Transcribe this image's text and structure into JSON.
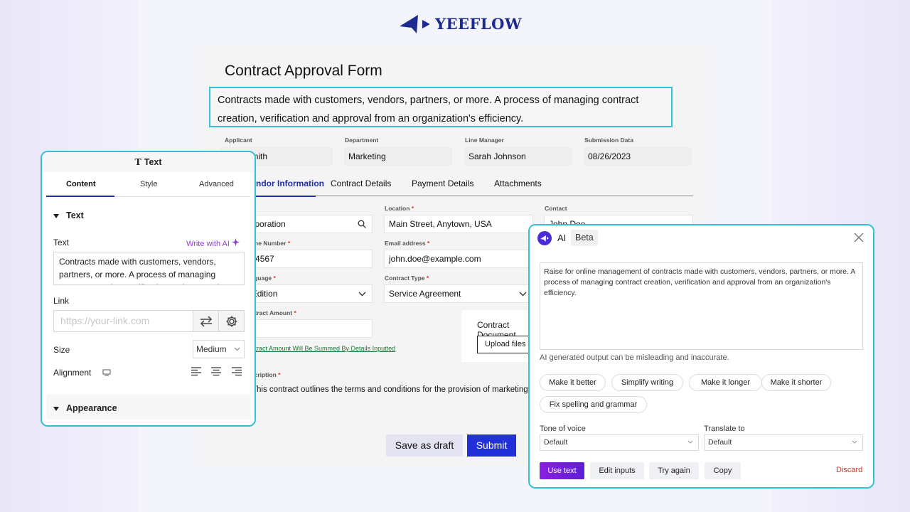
{
  "brand": {
    "name": "YEEFLOW",
    "color": "#1d2a8f"
  },
  "form": {
    "title": "Contract Approval Form",
    "description": "Contracts made with customers, vendors, partners, or more. A process of managing contract creation, verification and approval from an organization's efficiency.",
    "fields": {
      "applicant_label": "Applicant",
      "applicant_value": "John Smith",
      "department_label": "Department",
      "department_value": "Marketing",
      "manager_label": "Line Manager",
      "manager_value": "Sarah Johnson",
      "submission_label": "Submission Data",
      "submission_value": "08/26/2023"
    },
    "tabs": [
      "Vendor Information",
      "Contract Details",
      "Payment Details",
      "Attachments"
    ],
    "vendor": {
      "vendor_value": "ABC Corporation",
      "location_label": "Location",
      "location_value": "Main Street, Anytown, USA",
      "contact_label": "Contact",
      "contact_value": "John Doe",
      "phone_label": "Phone Number",
      "phone_value": "555-123-4567",
      "email_label": "Email address",
      "email_value": "john.doe@example.com",
      "language_label": "Language",
      "language_value": "English Edition",
      "type_label": "Contract Type",
      "type_value": "Service Agreement",
      "amount_label": "Contract Amount",
      "sum_note": "Contract Amount Will Be Summed By Details Inputted",
      "doc_title": "Contract Document",
      "upload_label": "Upload files",
      "desc_label": "Description",
      "desc_value": "This contract outlines the terms and conditions for the provision of marketing services"
    },
    "actions": {
      "draft": "Save as draft",
      "submit": "Submit"
    },
    "colors": {
      "accent": "#2130a8",
      "submit": "#2130d8",
      "highlight": "#34c1d8"
    }
  },
  "text_panel": {
    "header": "Text",
    "tabs": [
      "Content",
      "Style",
      "Advanced"
    ],
    "section_text": "Text",
    "text_label": "Text",
    "write_ai": "Write with AI",
    "text_value": "Contracts made with customers, vendors, partners, or more. A process of managing contract creation, verification and approval",
    "link_label": "Link",
    "link_placeholder": "https://your-link.com",
    "size_label": "Size",
    "size_value": "Medium",
    "alignment_label": "Alignment",
    "section_appearance": "Appearance"
  },
  "ai_panel": {
    "title": "AI",
    "badge": "Beta",
    "output": "Raise for online management of contracts made with customers, vendors, partners, or more. A process of managing contract creation, verification and approval from an organization's efficiency.",
    "warning": "AI generated output can be misleading and inaccurate.",
    "chips": [
      "Make it better",
      "Simplify writing",
      "Make it longer",
      "Make it shorter",
      "Fix spelling and grammar"
    ],
    "tone_label": "Tone of voice",
    "tone_value": "Default",
    "translate_label": "Translate to",
    "translate_value": "Default",
    "buttons": {
      "use": "Use text",
      "edit": "Edit inputs",
      "retry": "Try again",
      "copy": "Copy",
      "discard": "Discard"
    }
  }
}
